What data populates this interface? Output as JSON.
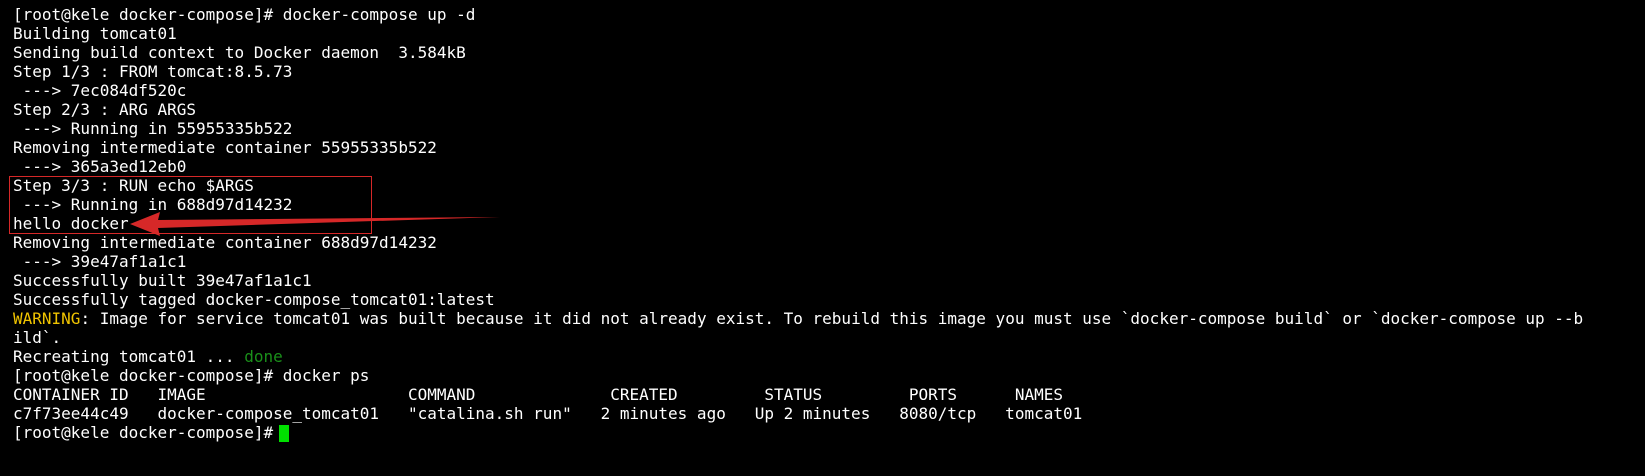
{
  "terminal": {
    "lines": [
      "[root@kele docker-compose]# docker-compose up -d",
      "Building tomcat01",
      "Sending build context to Docker daemon  3.584kB",
      "Step 1/3 : FROM tomcat:8.5.73",
      " ---> 7ec084df520c",
      "Step 2/3 : ARG ARGS",
      " ---> Running in 55955335b522",
      "Removing intermediate container 55955335b522",
      " ---> 365a3ed12eb0",
      "Step 3/3 : RUN echo $ARGS",
      " ---> Running in 688d97d14232",
      "hello docker",
      "Removing intermediate container 688d97d14232",
      " ---> 39e47af1a1c1",
      "Successfully built 39e47af1a1c1",
      "Successfully tagged docker-compose_tomcat01:latest"
    ],
    "warning": {
      "label": "WARNING",
      "text": ": Image for service tomcat01 was built because it did not already exist. To rebuild this image you must use `docker-compose build` or `docker-compose up --b",
      "continuation": "ild`."
    },
    "recreating": {
      "prefix": "Recreating tomcat01 ... ",
      "status": "done"
    },
    "ps_command": "[root@kele docker-compose]# docker ps",
    "ps_header": "CONTAINER ID   IMAGE                     COMMAND              CREATED         STATUS         PORTS      NAMES",
    "ps_row": "c7f73ee44c49   docker-compose_tomcat01   \"catalina.sh run\"   2 minutes ago   Up 2 minutes   8080/tcp   tomcat01",
    "prompt": "[root@kele docker-compose]#"
  },
  "colors": {
    "background": "#000000",
    "text": "#ffffff",
    "warning": "#f0c400",
    "done": "#1a8f1a",
    "cursor": "#00e000",
    "annotation": "#d62828"
  }
}
